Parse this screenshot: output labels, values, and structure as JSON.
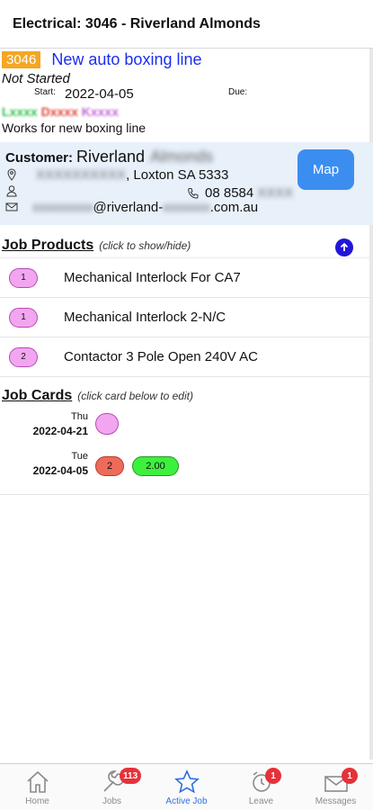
{
  "header": {
    "title": "Electrical: 3046 - Riverland Almonds"
  },
  "job": {
    "number": "3046",
    "title": "New auto boxing line",
    "status": "Not Started",
    "start_label": "Start:",
    "start_value": "2022-04-05",
    "due_label": "Due:",
    "techs": [
      "Lxxxx",
      "Dxxxx",
      "Kxxxx"
    ],
    "description": "Works for new boxing line"
  },
  "customer": {
    "label": "Customer:",
    "name": "Riverland",
    "name_blurred": "Almonds",
    "address_blurred": "XXXXXXXXXX",
    "address": ", Loxton SA 5333",
    "phone": "08 8584",
    "phone_blurred": "XXXX",
    "email_blurred": "xxxxxxxxx",
    "email_domain": "@riverland-",
    "email_domain_blurred": "xxxxxxx",
    "email_tld": ".com.au",
    "map_button": "Map"
  },
  "products_section": {
    "title": "Job Products",
    "hint": "(click to show/hide)"
  },
  "products": [
    {
      "qty": "1",
      "name": "Mechanical Interlock For CA7"
    },
    {
      "qty": "1",
      "name": "Mechanical Interlock 2-N/C"
    },
    {
      "qty": "2",
      "name": "Contactor 3 Pole Open 240V AC"
    }
  ],
  "cards_section": {
    "title": "Job Cards",
    "hint": "(click card below to edit)"
  },
  "job_cards": [
    {
      "day": "Thu",
      "date": "2022-04-21"
    },
    {
      "day": "Tue",
      "date": "2022-04-05",
      "count": "2",
      "hours": "2.00"
    }
  ],
  "tabbar": {
    "home": "Home",
    "jobs": "Jobs",
    "jobs_badge": "113",
    "active_job": "Active Job",
    "leave": "Leave",
    "leave_badge": "1",
    "messages": "Messages",
    "messages_badge": "1"
  },
  "colors": {
    "accent": "#3b8ef0",
    "job_title": "#1a2ef0",
    "job_number_bg": "#f5a623",
    "customer_bg": "#e8f0fa",
    "badge": "#e5323a"
  }
}
